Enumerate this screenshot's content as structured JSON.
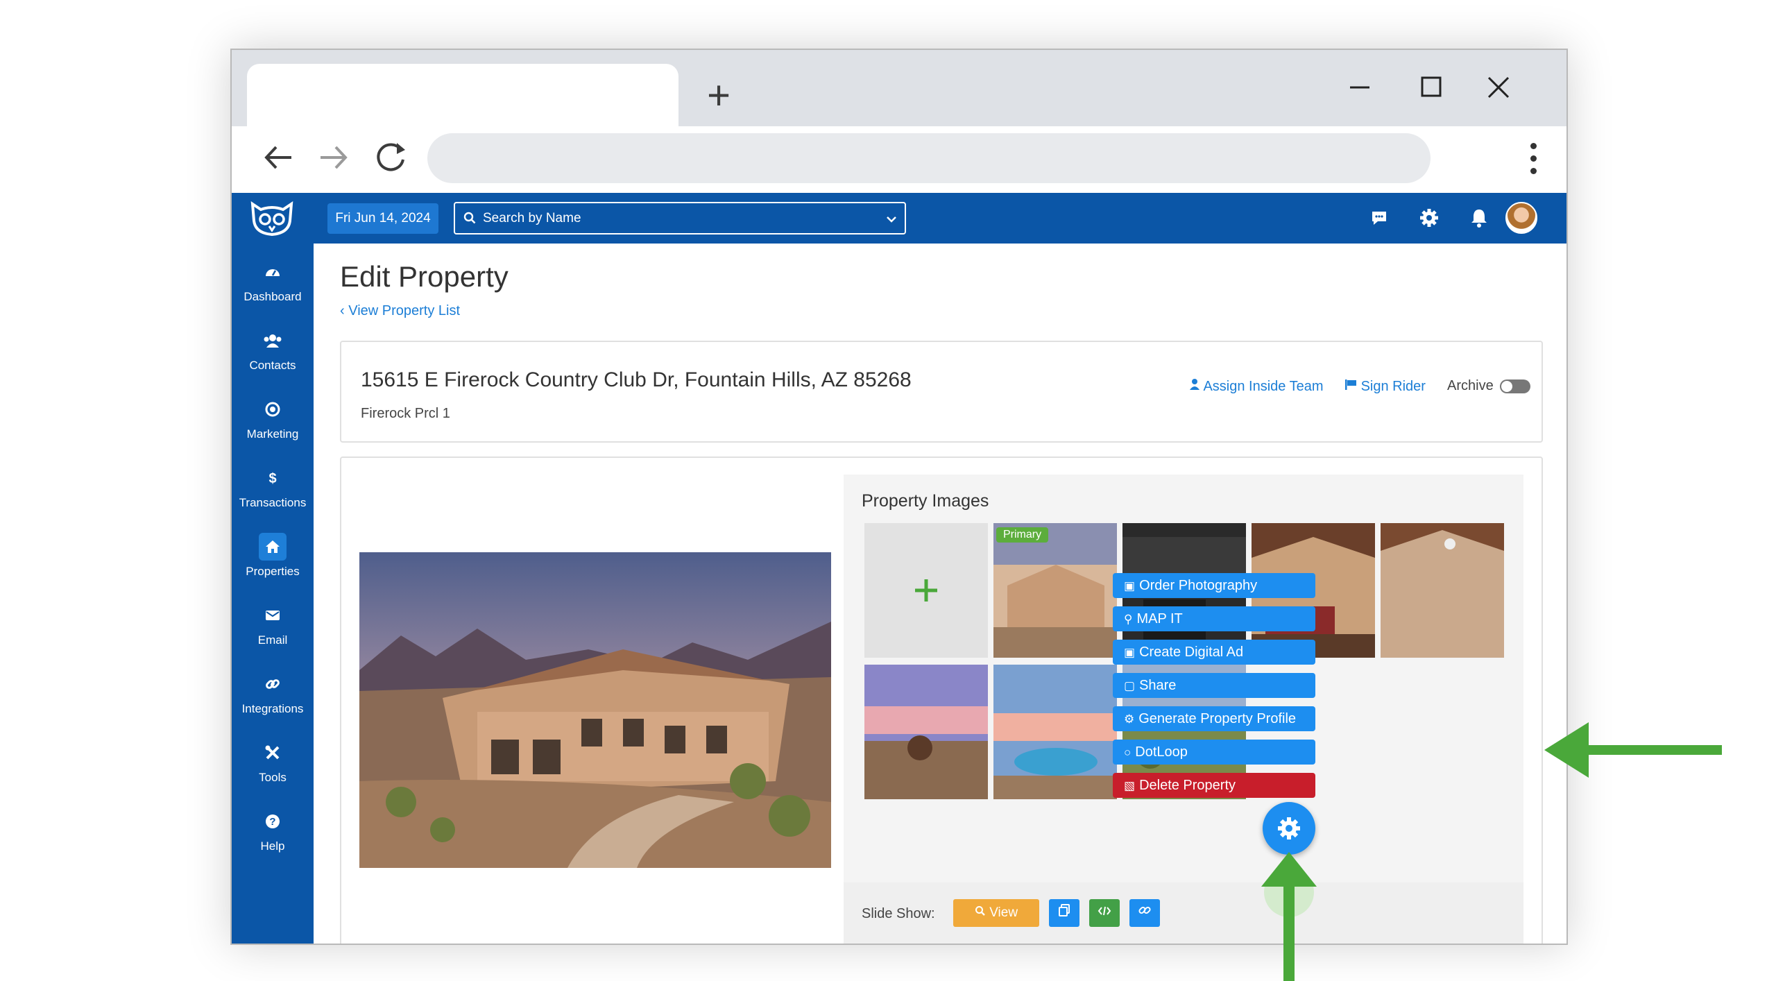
{
  "browser": {
    "new_tab_glyph": "+",
    "minimize_glyph": "—",
    "maximize_glyph": "☐",
    "close_glyph": "✕"
  },
  "topbar": {
    "date": "Fri Jun 14, 2024",
    "search_placeholder": "Search by Name"
  },
  "sidebar": {
    "items": [
      {
        "label": "Dashboard",
        "icon": "dashboard-icon"
      },
      {
        "label": "Contacts",
        "icon": "contacts-icon"
      },
      {
        "label": "Marketing",
        "icon": "marketing-icon"
      },
      {
        "label": "Transactions",
        "icon": "dollar-icon"
      },
      {
        "label": "Properties",
        "icon": "home-icon",
        "active": true
      },
      {
        "label": "Email",
        "icon": "envelope-icon"
      },
      {
        "label": "Integrations",
        "icon": "link-icon"
      },
      {
        "label": "Tools",
        "icon": "tools-icon"
      },
      {
        "label": "Help",
        "icon": "help-icon"
      }
    ]
  },
  "page": {
    "title": "Edit Property",
    "back_link": "View Property List"
  },
  "property": {
    "address": "15615 E Firerock Country Club Dr, Fountain Hills, AZ 85268",
    "subdivision": "Firerock Prcl 1",
    "assign_team": "Assign Inside Team",
    "sign_rider": "Sign Rider",
    "archive_label": "Archive"
  },
  "images": {
    "title": "Property Images",
    "primary_badge": "Primary",
    "add_glyph": "+"
  },
  "slideshow": {
    "label": "Slide Show:",
    "view_label": "View"
  },
  "actions_menu": {
    "order_photography": "Order Photography",
    "map_it": "MAP IT",
    "create_digital_ad": "Create Digital Ad",
    "share": "Share",
    "generate_profile": "Generate Property Profile",
    "dotloop": "DotLoop",
    "delete_property": "Delete Property"
  },
  "colors": {
    "brand_blue": "#0b56a7",
    "accent_blue": "#1d8ef0",
    "danger": "#c81e2b",
    "success_green": "#5cad3c",
    "arrow_green": "#4aa83a",
    "slideshow_orange": "#f0a93a"
  }
}
